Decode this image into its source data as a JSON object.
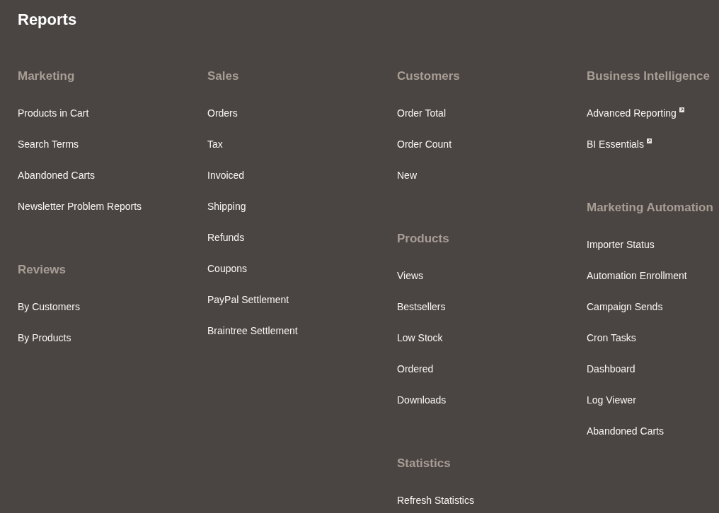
{
  "page": {
    "title": "Reports"
  },
  "columns": [
    {
      "groups": [
        {
          "title": "Marketing",
          "items": [
            {
              "label": "Products in Cart"
            },
            {
              "label": "Search Terms"
            },
            {
              "label": "Abandoned Carts"
            },
            {
              "label": "Newsletter Problem Reports"
            }
          ]
        },
        {
          "title": "Reviews",
          "items": [
            {
              "label": "By Customers"
            },
            {
              "label": "By Products"
            }
          ]
        }
      ]
    },
    {
      "groups": [
        {
          "title": "Sales",
          "items": [
            {
              "label": "Orders"
            },
            {
              "label": "Tax"
            },
            {
              "label": "Invoiced"
            },
            {
              "label": "Shipping"
            },
            {
              "label": "Refunds"
            },
            {
              "label": "Coupons"
            },
            {
              "label": "PayPal Settlement"
            },
            {
              "label": "Braintree Settlement"
            }
          ]
        }
      ]
    },
    {
      "groups": [
        {
          "title": "Customers",
          "items": [
            {
              "label": "Order Total"
            },
            {
              "label": "Order Count"
            },
            {
              "label": "New"
            }
          ]
        },
        {
          "title": "Products",
          "items": [
            {
              "label": "Views"
            },
            {
              "label": "Bestsellers"
            },
            {
              "label": "Low Stock"
            },
            {
              "label": "Ordered"
            },
            {
              "label": "Downloads"
            }
          ]
        },
        {
          "title": "Statistics",
          "items": [
            {
              "label": "Refresh Statistics"
            }
          ]
        }
      ]
    },
    {
      "groups": [
        {
          "title": "Business Intelligence",
          "items": [
            {
              "label": "Advanced Reporting",
              "external": true
            },
            {
              "label": "BI Essentials",
              "external": true
            }
          ]
        },
        {
          "title": "Marketing Automation",
          "items": [
            {
              "label": "Importer Status"
            },
            {
              "label": "Automation Enrollment"
            },
            {
              "label": "Campaign Sends"
            },
            {
              "label": "Cron Tasks"
            },
            {
              "label": "Dashboard"
            },
            {
              "label": "Log Viewer"
            },
            {
              "label": "Abandoned Carts"
            }
          ]
        }
      ]
    }
  ]
}
